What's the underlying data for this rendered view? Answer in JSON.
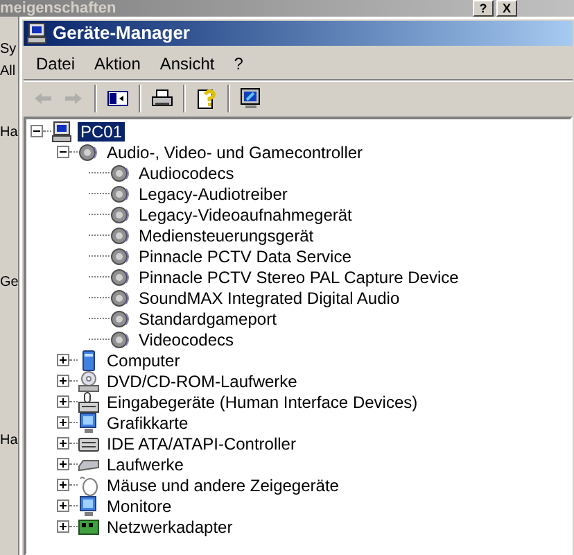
{
  "background_window": {
    "title": "meigenschaften",
    "title_buttons": [
      "?",
      "X"
    ],
    "side_texts": [
      "Sy",
      "All",
      "Ha",
      "Ge",
      "Ha"
    ]
  },
  "window": {
    "title": "Geräte-Manager"
  },
  "menu": [
    {
      "label": "Datei"
    },
    {
      "label": "Aktion"
    },
    {
      "label": "Ansicht"
    },
    {
      "label": "?"
    }
  ],
  "toolbar": [
    {
      "disabled": true
    },
    {
      "disabled": true
    },
    {
      "disabled": false
    },
    {
      "disabled": false
    },
    {
      "disabled": false
    },
    {
      "disabled": false
    }
  ],
  "tree": [
    {
      "label": "PC01",
      "selected": true,
      "expanded": true,
      "children": [
        {
          "label": "Audio-, Video- und Gamecontroller",
          "selected": false,
          "expanded": true,
          "children": [
            {
              "label": "Audiocodecs",
              "selected": false
            },
            {
              "label": "Legacy-Audiotreiber",
              "selected": false
            },
            {
              "label": "Legacy-Videoaufnahmegerät",
              "selected": false
            },
            {
              "label": "Mediensteuerungsgerät",
              "selected": false
            },
            {
              "label": "Pinnacle PCTV Data Service",
              "selected": false
            },
            {
              "label": "Pinnacle PCTV Stereo PAL Capture Device",
              "selected": false
            },
            {
              "label": "SoundMAX Integrated Digital Audio",
              "selected": false
            },
            {
              "label": "Standardgameport",
              "selected": false
            },
            {
              "label": "Videocodecs",
              "selected": false
            }
          ]
        },
        {
          "label": "Computer",
          "selected": false,
          "expanded": false
        },
        {
          "label": "DVD/CD-ROM-Laufwerke",
          "selected": false,
          "expanded": false
        },
        {
          "label": "Eingabegeräte (Human Interface Devices)",
          "selected": false,
          "expanded": false
        },
        {
          "label": "Grafikkarte",
          "selected": false,
          "expanded": false
        },
        {
          "label": "IDE ATA/ATAPI-Controller",
          "selected": false,
          "expanded": false
        },
        {
          "label": "Laufwerke",
          "selected": false,
          "expanded": false
        },
        {
          "label": "Mäuse und andere Zeigegeräte",
          "selected": false,
          "expanded": false
        },
        {
          "label": "Monitore",
          "selected": false,
          "expanded": false
        },
        {
          "label": "Netzwerkadapter",
          "selected": false,
          "expanded": false
        }
      ]
    }
  ]
}
